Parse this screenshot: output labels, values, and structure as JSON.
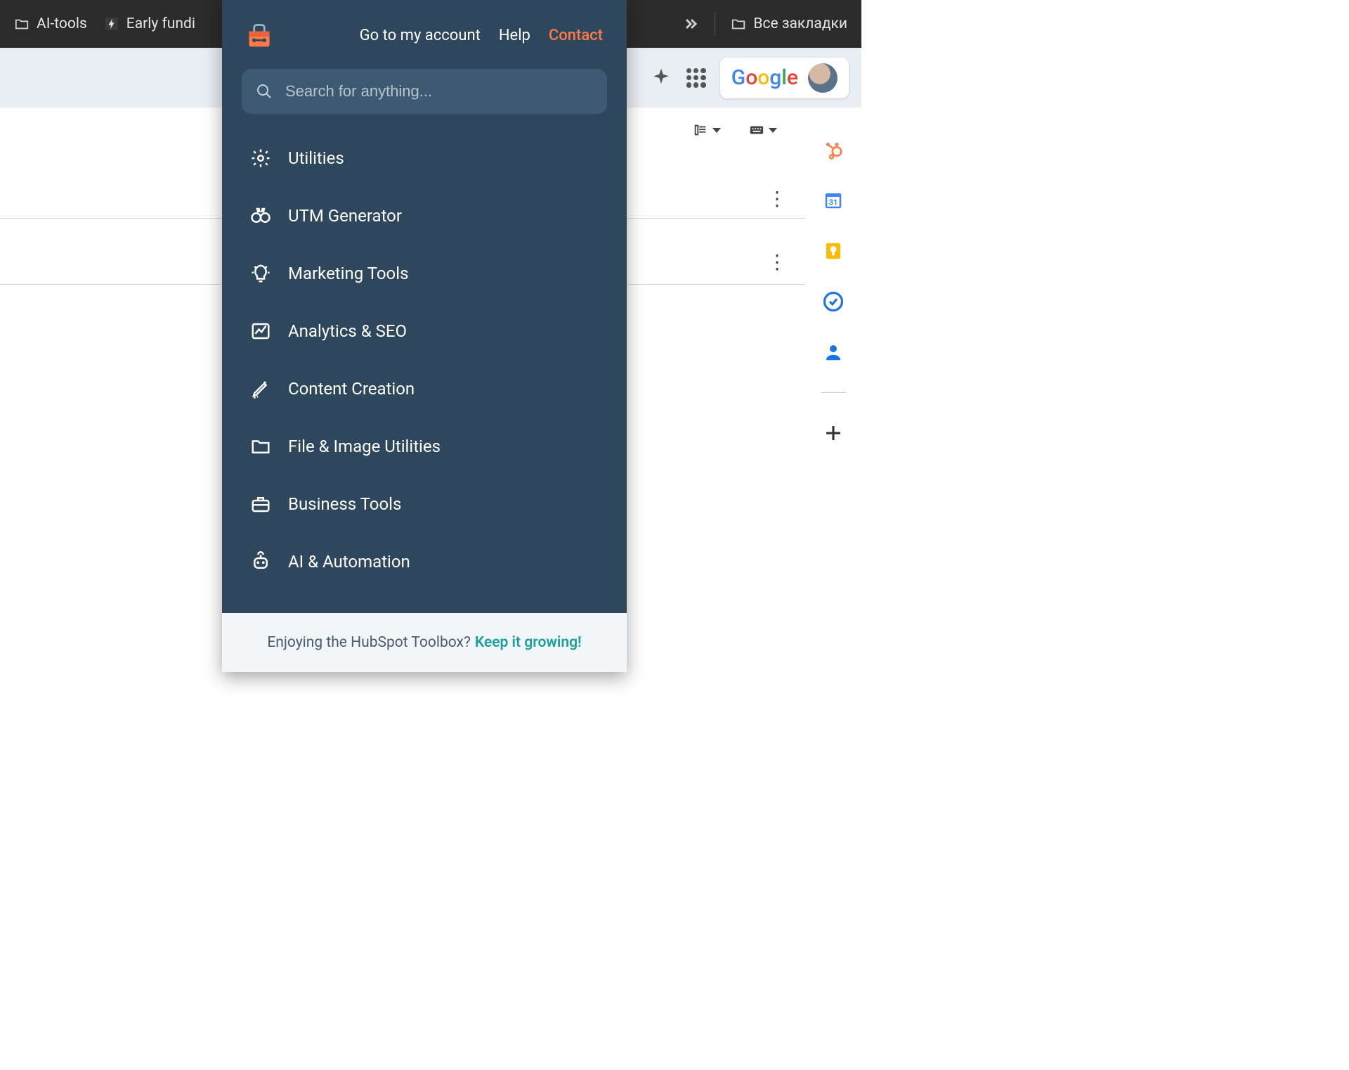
{
  "browser": {
    "bookmarks": [
      {
        "label": "AI-tools",
        "icon": "folder"
      },
      {
        "label": "Early fundi",
        "icon": "bolt"
      }
    ],
    "all_bookmarks": "Все закладки"
  },
  "google": {
    "logo_letters": [
      "G",
      "o",
      "o",
      "g",
      "l",
      "e"
    ]
  },
  "popup": {
    "links": {
      "account": "Go to my account",
      "help": "Help",
      "contact": "Contact"
    },
    "search_placeholder": "Search for anything...",
    "menu": [
      {
        "label": "Utilities",
        "icon": "gear"
      },
      {
        "label": "UTM Generator",
        "icon": "binoculars"
      },
      {
        "label": "Marketing Tools",
        "icon": "bulb"
      },
      {
        "label": "Analytics & SEO",
        "icon": "chart"
      },
      {
        "label": "Content Creation",
        "icon": "pen"
      },
      {
        "label": "File & Image Utilities",
        "icon": "folder"
      },
      {
        "label": "Business Tools",
        "icon": "briefcase"
      },
      {
        "label": "AI & Automation",
        "icon": "robot"
      }
    ],
    "footer_text": "Enjoying the HubSpot Toolbox?",
    "footer_cta": "Keep it growing!"
  },
  "side_panel": {
    "icons": [
      "hubspot",
      "calendar",
      "keep",
      "tasks",
      "contacts"
    ]
  }
}
